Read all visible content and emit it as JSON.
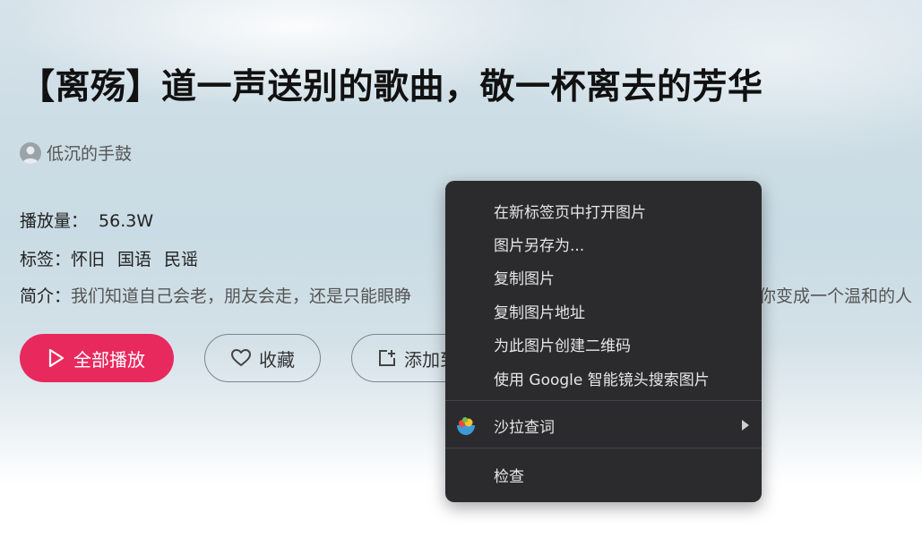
{
  "playlist": {
    "title": "【离殇】道一声送别的歌曲，敬一杯离去的芳华",
    "author": "低沉的手鼓",
    "plays_label": "播放量：",
    "plays_value": "56.3W",
    "tags_label": "标签：",
    "tags": [
      "怀旧",
      "国语",
      "民谣"
    ],
    "intro_label": "简介：",
    "intro_text_visible": "我们知道自己会老，朋友会走，还是只能眼睁",
    "intro_text_tail": "你变成一个温和的人"
  },
  "actions": {
    "play_all": "全部播放",
    "favorite": "收藏",
    "add": "添加到"
  },
  "context_menu": {
    "items": [
      "在新标签页中打开图片",
      "图片另存为...",
      "复制图片",
      "复制图片地址",
      "为此图片创建二维码",
      "使用 Google 智能镜头搜索图片"
    ],
    "extension_item": "沙拉查词",
    "inspect": "检查"
  },
  "colors": {
    "accent": "#e8295e",
    "menu_bg": "#2b2b2e",
    "menu_text": "#e6e6e6"
  }
}
